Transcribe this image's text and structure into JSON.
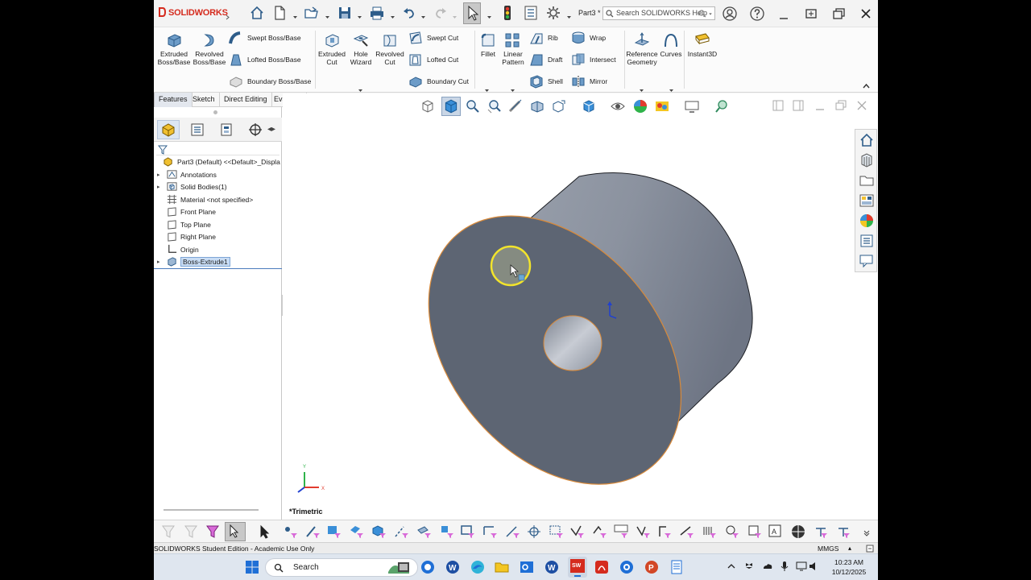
{
  "app": {
    "logo_text": "SOLIDWORKS",
    "document_title": "Part3 *",
    "search_placeholder": "Search SOLIDWORKS Help"
  },
  "ribbon": {
    "extruded_boss": "Extruded Boss/Base",
    "revolved_boss": "Revolved Boss/Base",
    "swept_boss": "Swept Boss/Base",
    "lofted_boss": "Lofted Boss/Base",
    "boundary_boss": "Boundary Boss/Base",
    "extruded_cut": "Extruded Cut",
    "hole_wizard": "Hole Wizard",
    "revolved_cut": "Revolved Cut",
    "swept_cut": "Swept Cut",
    "lofted_cut": "Lofted Cut",
    "boundary_cut": "Boundary Cut",
    "fillet": "Fillet",
    "linear_pattern": "Linear Pattern",
    "rib": "Rib",
    "draft": "Draft",
    "shell": "Shell",
    "wrap": "Wrap",
    "intersect": "Intersect",
    "mirror": "Mirror",
    "reference_geometry": "Reference Geometry",
    "curves": "Curves",
    "instant3d": "Instant3D"
  },
  "tabs": [
    "Features",
    "Sketch",
    "Direct Editing",
    "Evaluate"
  ],
  "tree": {
    "root": "Part3 (Default) <<Default>_Displa",
    "items": [
      {
        "label": "Annotations",
        "expandable": true
      },
      {
        "label": "Solid Bodies(1)",
        "expandable": true
      },
      {
        "label": "Material <not specified>",
        "expandable": false
      },
      {
        "label": "Front Plane",
        "expandable": false
      },
      {
        "label": "Top Plane",
        "expandable": false
      },
      {
        "label": "Right Plane",
        "expandable": false
      },
      {
        "label": "Origin",
        "expandable": false
      },
      {
        "label": "Boss-Extrude1",
        "expandable": true,
        "selected": true
      }
    ]
  },
  "viewport": {
    "view_name": "*Trimetric",
    "part_color": "#5d6573",
    "edge_highlight": "#d98a3a"
  },
  "status": {
    "text": "SOLIDWORKS Student Edition - Academic Use Only",
    "units": "MMGS"
  },
  "taskbar": {
    "search_label": "Search",
    "time": "10:23 AM",
    "date": "10/12/2025"
  }
}
